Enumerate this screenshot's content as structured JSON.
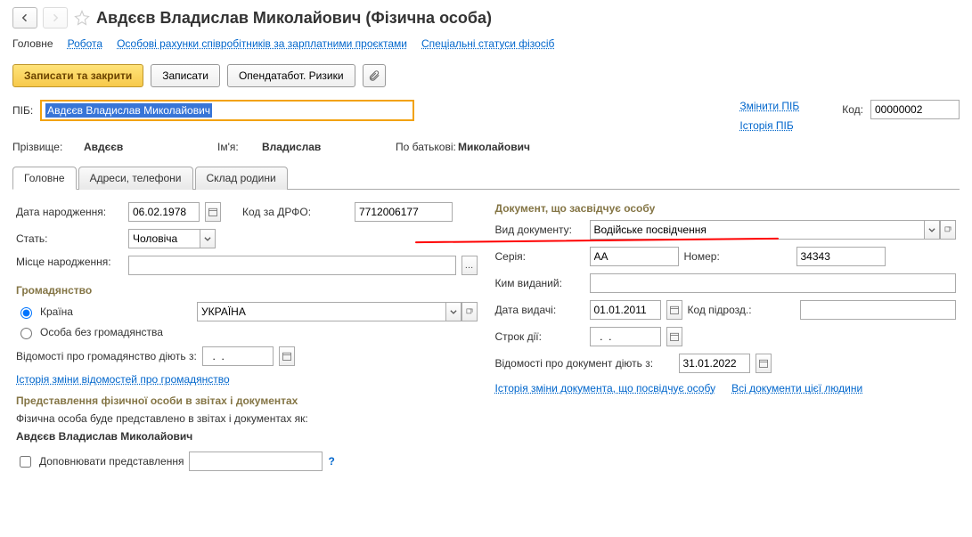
{
  "header": {
    "title": "Авдєєв Владислав Миколайович (Фізична особа)"
  },
  "navtabs": {
    "main": "Головне",
    "work": "Робота",
    "accounts": "Особові рахунки співробітників за зарплатними проєктами",
    "statuses": "Спеціальні статуси фізосіб"
  },
  "toolbar": {
    "save_close": "Записати та закрити",
    "save": "Записати",
    "opendatabot": "Опендатабот. Ризики"
  },
  "pib": {
    "label": "ПІБ:",
    "value": "Авдєєв Владислав Миколайович",
    "change": "Змінити ПІБ",
    "history": "Історія ПІБ",
    "code_label": "Код:",
    "code_value": "00000002"
  },
  "name": {
    "surname_lbl": "Прізвище:",
    "surname": "Авдєєв",
    "first_lbl": "Ім'я:",
    "first": "Владислав",
    "patr_lbl": "По батькові:",
    "patr": "Миколайович"
  },
  "tabs": {
    "main": "Головне",
    "addresses": "Адреси, телефони",
    "family": "Склад родини"
  },
  "left": {
    "dob_lbl": "Дата народження:",
    "dob": "06.02.1978",
    "drfo_lbl": "Код за ДРФО:",
    "drfo": "7712006177",
    "sex_lbl": "Стать:",
    "sex": "Чоловіча",
    "birthplace_lbl": "Місце народження:",
    "birthplace": "",
    "citizenship_title": "Громадянство",
    "radio_country": "Країна",
    "country_value": "УКРАЇНА",
    "radio_none": "Особа без громадянства",
    "cit_valid_lbl": "Відомості про громадянство діють з:",
    "cit_valid": "  .  .    ",
    "cit_history": "Історія зміни відомостей про громадянство",
    "repr_title": "Представлення фізичної особи в звітах і документах",
    "repr_text": "Фізична особа буде представлено в звітах і документах як:",
    "repr_value": "Авдєєв Владислав Миколайович",
    "repr_check": "Доповнювати представлення"
  },
  "right": {
    "doc_title": "Документ, що засвідчує особу",
    "doctype_lbl": "Вид документу:",
    "doctype_value": "Водійське посвідчення",
    "series_lbl": "Серія:",
    "series": "АА",
    "number_lbl": "Номер:",
    "number": "34343",
    "issued_lbl": "Ким виданий:",
    "issued": "",
    "issue_date_lbl": "Дата видачі:",
    "issue_date": "01.01.2011",
    "dept_lbl": "Код підрозд.:",
    "dept": "",
    "term_lbl": "Строк дії:",
    "term": "  .  .    ",
    "doc_valid_lbl": "Відомості про документ діють з:",
    "doc_valid": "31.01.2022",
    "doc_history": "Історія зміни документа, що посвідчує особу",
    "all_docs": "Всі документи цієї людини"
  }
}
